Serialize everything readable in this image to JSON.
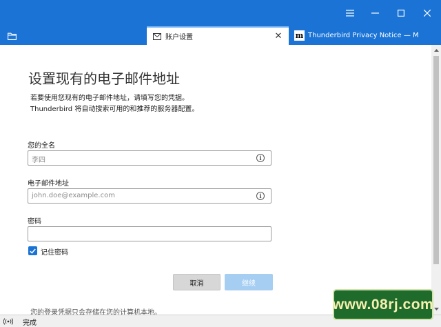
{
  "window": {
    "controls": {
      "menu_icon": "hamburger-icon",
      "minimize_icon": "minimize-icon",
      "maximize_icon": "maximize-icon",
      "close_icon": "close-icon"
    }
  },
  "tabs": [
    {
      "label": "账户设置",
      "icon": "mail-icon",
      "active": true
    },
    {
      "label": "Thunderbird Privacy Notice — M",
      "icon": "mozilla-m-icon",
      "active": false
    }
  ],
  "page": {
    "heading": "设置现有的电子邮件地址",
    "description_line1": "若要使用您现有的电子邮件地址，请填写您的凭据。",
    "description_line2": "Thunderbird 将自动搜索可用的和推荐的服务器配置。",
    "name_field": {
      "label": "您的全名",
      "placeholder": "李四",
      "value": ""
    },
    "email_field": {
      "label": "电子邮件地址",
      "placeholder": "john.doe@example.com",
      "value": ""
    },
    "password_field": {
      "label": "密码",
      "value": ""
    },
    "remember_password": {
      "label": "记住密码",
      "checked": true
    },
    "cancel_label": "取消",
    "continue_label": "继续",
    "footnote": "您的登录凭据只会存储在您的计算机本地。"
  },
  "statusbar": {
    "text": "完成"
  },
  "watermark": {
    "text": "www.08rj.com"
  },
  "colors": {
    "accent": "#1a73d5",
    "button_disabled": "#a6cef3"
  }
}
